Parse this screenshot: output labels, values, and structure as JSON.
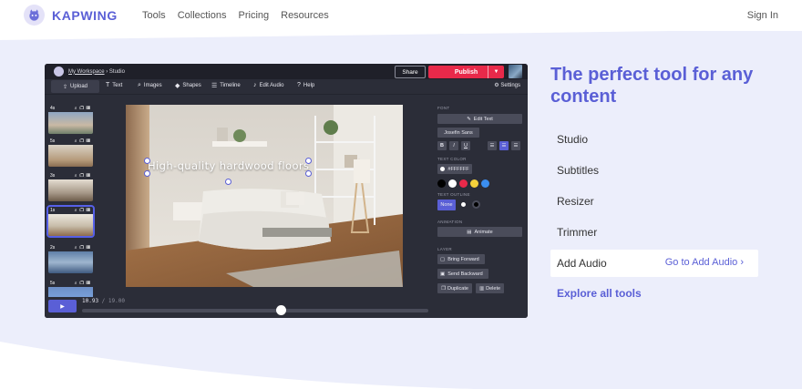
{
  "brand": {
    "name": "KAPWING",
    "color": "#5a5fd6"
  },
  "nav": {
    "links": [
      "Tools",
      "Collections",
      "Pricing",
      "Resources"
    ],
    "signin": "Sign In"
  },
  "editor": {
    "breadcrumb_workspace": "My Workspace",
    "breadcrumb_sep": " › ",
    "breadcrumb_page": "Studio",
    "share": "Share",
    "publish": "Publish",
    "toolbar": {
      "upload": "Upload",
      "text": "Text",
      "images": "Images",
      "shapes": "Shapes",
      "timeline": "Timeline",
      "edit_audio": "Edit Audio",
      "help": "Help",
      "settings": "Settings"
    },
    "scenes": [
      {
        "label": "4s"
      },
      {
        "label": "5s"
      },
      {
        "label": "3s"
      },
      {
        "label": "1s"
      },
      {
        "label": "2s"
      },
      {
        "label": "5s"
      }
    ],
    "canvas_text": "High-quality hardwood floors",
    "properties": {
      "font_label": "FONT",
      "edit_text": "Edit Text",
      "font_name": "Josefin Sans",
      "text_color_label": "TEXT COLOR",
      "text_color_value": "#FFFFFF",
      "swatches": [
        "#000000",
        "#ffffff",
        "#e8294a",
        "#f5d13b",
        "#3b8ef0"
      ],
      "text_outline_label": "TEXT OUTLINE",
      "outline_none": "None",
      "animation_label": "ANIMATION",
      "animate": "Animate",
      "layer_label": "LAYER",
      "bring_forward": "Bring Forward",
      "send_backward": "Send Backward",
      "duplicate": "Duplicate",
      "delete": "Delete"
    },
    "timecode_current": "10.93",
    "timecode_total": " / 19.00"
  },
  "hero": {
    "headline": "The perfect tool for any content",
    "tools": [
      "Studio",
      "Subtitles",
      "Resizer",
      "Trimmer",
      "Add Audio"
    ],
    "active_tool_cta": "Go to Add Audio",
    "explore": "Explore all tools"
  }
}
